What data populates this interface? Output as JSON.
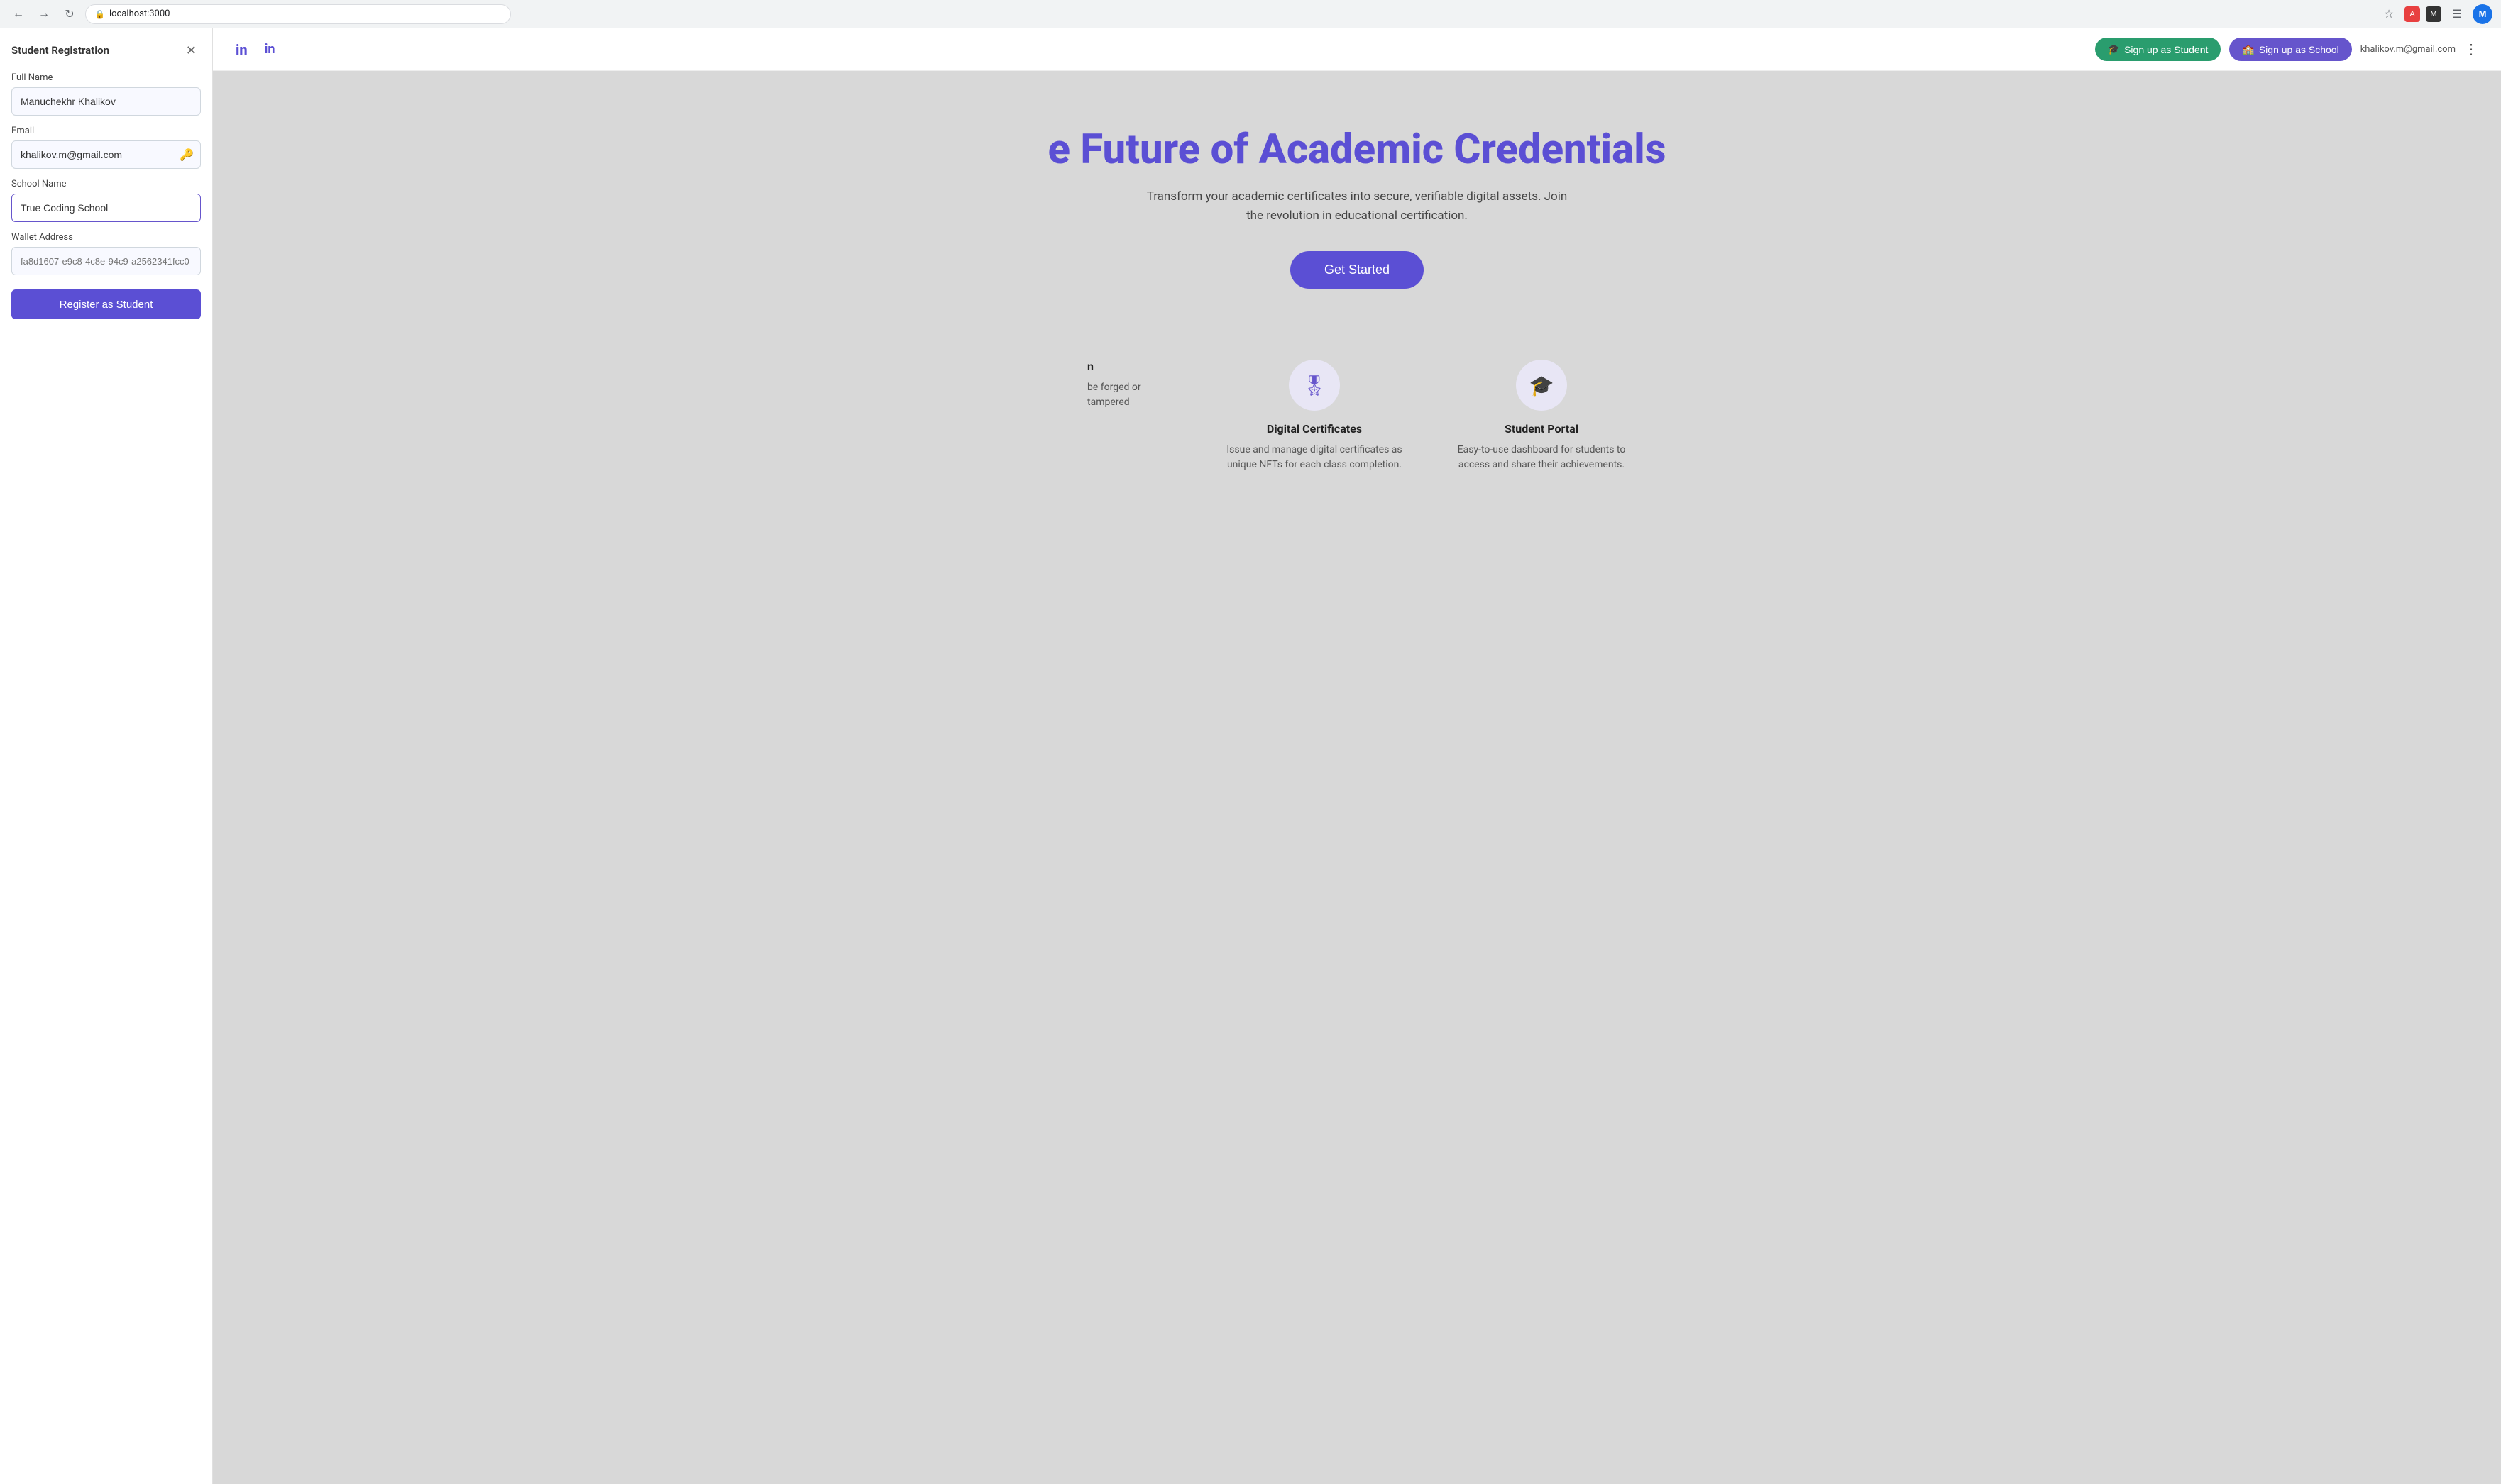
{
  "browser": {
    "url": "localhost:3000",
    "profile_initial": "M",
    "back_icon": "←",
    "forward_icon": "→",
    "reload_icon": "↻",
    "star_icon": "☆",
    "lock_icon": "🔒"
  },
  "registration_panel": {
    "title": "Student Registration",
    "close_icon": "✕",
    "full_name_label": "Full Name",
    "full_name_value": "Manuchekhr Khalikov",
    "email_label": "Email",
    "email_value": "khalikov.m@gmail.com",
    "email_icon": "🔑",
    "school_name_label": "School Name",
    "school_name_value": "True Coding School",
    "wallet_label": "Wallet Address",
    "wallet_placeholder": "fa8d1607-e9c8-4c8e-94c9-a2562341fcc0",
    "register_btn_label": "Register as Student"
  },
  "navbar": {
    "logo_text": "in",
    "signin_text": "in",
    "signup_student_label": "Sign up as Student",
    "signup_school_label": "Sign up as School",
    "user_email": "khalikov.m@gmail.com",
    "menu_icon": "⋮"
  },
  "hero": {
    "title": "e Future of Academic Credentials",
    "subtitle": "Transform your academic certificates into secure, verifiable digital assets. Join the revolution in educational certification.",
    "cta_label": "Get Started"
  },
  "features": {
    "partial": {
      "title": "n",
      "description": "be forged or tampered"
    },
    "digital_certificates": {
      "title": "Digital Certificates",
      "description": "Issue and manage digital certificates as unique NFTs for each class completion.",
      "icon": "🎖"
    },
    "student_portal": {
      "title": "Student Portal",
      "description": "Easy-to-use dashboard for students to access and share their achievements.",
      "icon": "🎓"
    }
  },
  "bottom_bar": {
    "icon": "⚡"
  }
}
